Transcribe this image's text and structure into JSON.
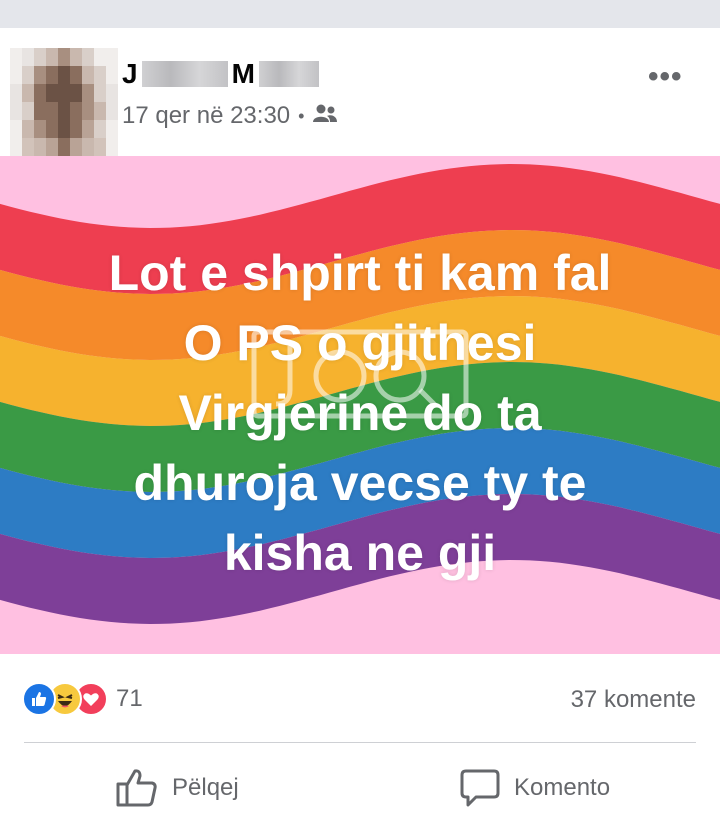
{
  "post": {
    "author_initial_1": "J",
    "author_initial_2": "M",
    "timestamp": "17 qer në 23:30",
    "separator": "•",
    "audience_icon": "friends-icon",
    "more_icon": "more-options-icon",
    "more_label": "•••"
  },
  "image": {
    "lines": [
      "Lot e shpirt ti kam fal",
      "O PS o gjithesi",
      "Virgjerine do ta",
      "dhuroja vecse ty te",
      "kisha ne gji"
    ],
    "background_color": "#ffc0e1",
    "stripe_colors": [
      "#ee3e50",
      "#f58a2a",
      "#f6b22e",
      "#3a9a45",
      "#2d7cc4",
      "#7e3f98"
    ]
  },
  "stats": {
    "reaction_count": "71",
    "comments_label": "37 komente",
    "reaction_icons": [
      "like-reaction-icon",
      "haha-reaction-icon",
      "love-reaction-icon"
    ]
  },
  "actions": {
    "like_label": "Pëlqej",
    "comment_label": "Komento"
  },
  "colors": {
    "accent_blue": "#1b74e4",
    "secondary_text": "#65676b"
  }
}
